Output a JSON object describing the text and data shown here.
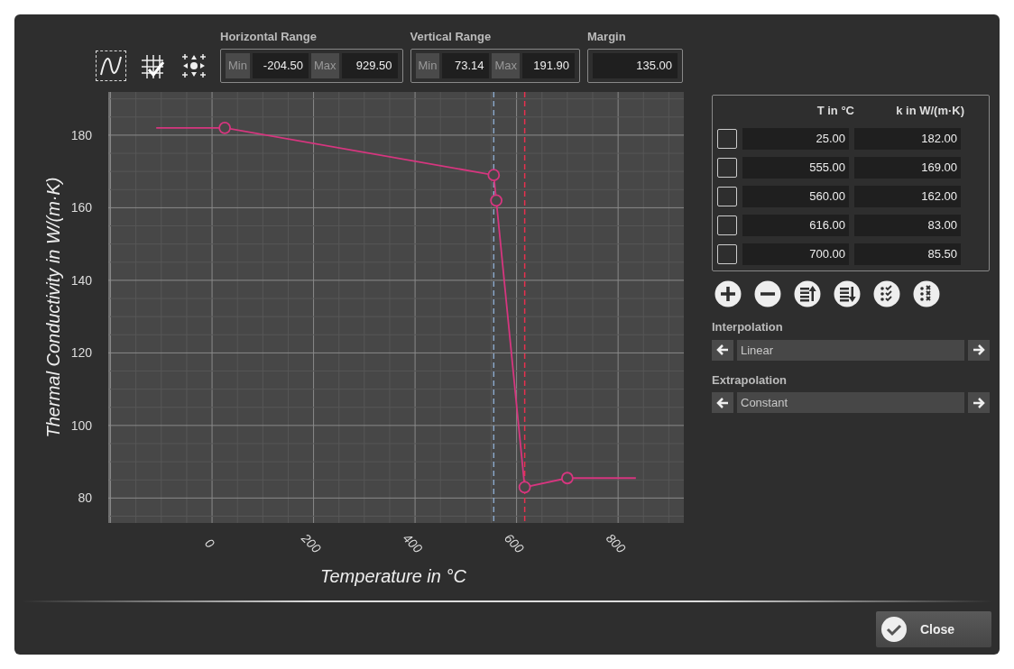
{
  "toolbar": {
    "tools": [
      {
        "kind": "curve",
        "selected": true
      },
      {
        "kind": "grid-check",
        "selected": false
      },
      {
        "kind": "move",
        "selected": false
      }
    ]
  },
  "horizontal_range": {
    "title": "Horizontal Range",
    "min_label": "Min",
    "min": "-204.50",
    "max_label": "Max",
    "max": "929.50"
  },
  "vertical_range": {
    "title": "Vertical Range",
    "min_label": "Min",
    "min": "73.14",
    "max_label": "Max",
    "max": "191.90"
  },
  "margin": {
    "title": "Margin",
    "value": "135.00"
  },
  "chart": {
    "chart_data": {
      "type": "line",
      "xlabel": "Temperature in °C",
      "ylabel": "Thermal Conductivity in W/(m·K)",
      "x": [
        -110,
        25,
        555,
        560,
        616,
        700,
        835
      ],
      "series": [
        {
          "color": "#d6367f",
          "marker": "o",
          "values": [
            null,
            182,
            169,
            162,
            83,
            85.5,
            null
          ]
        },
        {
          "color": "#d6367f",
          "values": [
            182,
            182,
            null,
            null,
            null,
            85.5,
            85.5
          ]
        }
      ],
      "grid": true,
      "xlim": [
        -204.5,
        929.5
      ],
      "ylim": [
        73.14,
        191.9
      ],
      "xticks": [
        0,
        200,
        400,
        600,
        800
      ],
      "yticks": [
        80,
        100,
        120,
        140,
        160,
        180
      ],
      "ref_lines": [
        {
          "axis": "x",
          "value": 555,
          "color": "#8aa6c8"
        },
        {
          "axis": "x",
          "value": 616,
          "color": "#e8304f"
        }
      ]
    }
  },
  "table": {
    "columns": [
      "T in °C",
      "k in W/(m·K)"
    ],
    "rows": [
      {
        "checked": false,
        "t": "25.00",
        "k": "182.00"
      },
      {
        "checked": false,
        "t": "555.00",
        "k": "169.00"
      },
      {
        "checked": false,
        "t": "560.00",
        "k": "162.00"
      },
      {
        "checked": false,
        "t": "616.00",
        "k": "83.00"
      },
      {
        "checked": false,
        "t": "700.00",
        "k": "85.50"
      }
    ]
  },
  "actions": [
    {
      "kind": "add"
    },
    {
      "kind": "remove"
    },
    {
      "kind": "sort-ascending"
    },
    {
      "kind": "sort-descending"
    },
    {
      "kind": "select-all"
    },
    {
      "kind": "deselect-all"
    }
  ],
  "interpolation": {
    "label": "Interpolation",
    "value": "Linear"
  },
  "extrapolation": {
    "label": "Extrapolation",
    "value": "Constant"
  },
  "close_button": "Close"
}
